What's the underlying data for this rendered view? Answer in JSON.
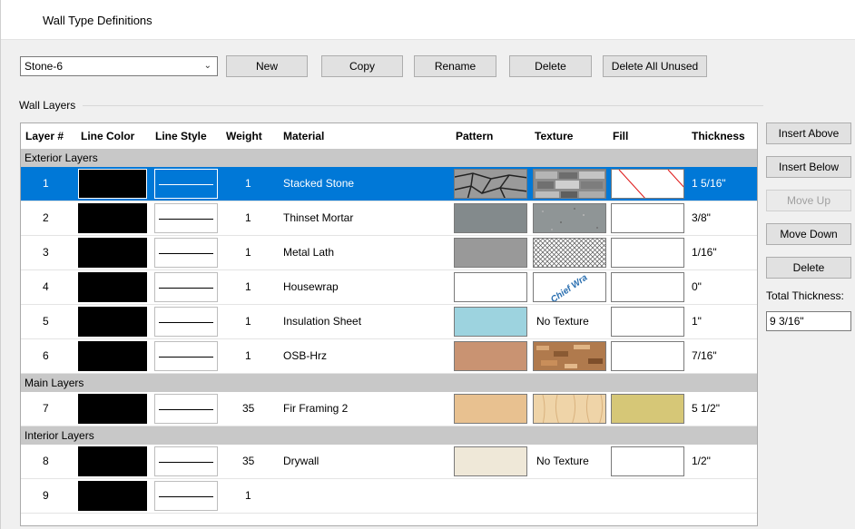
{
  "window": {
    "title": "Wall Type Definitions"
  },
  "toolbar": {
    "wall_type_value": "Stone-6",
    "new_label": "New",
    "copy_label": "Copy",
    "rename_label": "Rename",
    "delete_label": "Delete",
    "delete_all_unused_label": "Delete All Unused"
  },
  "group": {
    "label": "Wall Layers"
  },
  "columns": {
    "layer": "Layer #",
    "line_color": "Line Color",
    "line_style": "Line Style",
    "weight": "Weight",
    "material": "Material",
    "pattern": "Pattern",
    "texture": "Texture",
    "fill": "Fill",
    "thickness": "Thickness"
  },
  "sections": {
    "exterior": "Exterior Layers",
    "main": "Main Layers",
    "interior": "Interior Layers"
  },
  "rows": [
    {
      "layer": "1",
      "weight": "1",
      "material": "Stacked Stone",
      "thickness": "1 5/16\"",
      "pattern_color": "#9a9a9a",
      "texture": "stone-texture",
      "fill": "hatch-fill"
    },
    {
      "layer": "2",
      "weight": "1",
      "material": "Thinset Mortar",
      "thickness": "3/8\"",
      "pattern_color": "#838a8c",
      "texture": "gray-texture",
      "fill": "none"
    },
    {
      "layer": "3",
      "weight": "1",
      "material": "Metal Lath",
      "thickness": "1/16\"",
      "pattern_color": "#999999",
      "texture": "mesh-texture",
      "fill": "none"
    },
    {
      "layer": "4",
      "weight": "1",
      "material": "Housewrap",
      "thickness": "0\"",
      "pattern_color": "#ffffff",
      "texture": "housewrap-texture",
      "texture_text": "Chief Wra",
      "fill": "none"
    },
    {
      "layer": "5",
      "weight": "1",
      "material": "Insulation  Sheet",
      "thickness": "1\"",
      "pattern_color": "#9dd3df",
      "texture_text": "No Texture",
      "fill": "none"
    },
    {
      "layer": "6",
      "weight": "1",
      "material": "OSB-Hrz",
      "thickness": "7/16\"",
      "pattern_color": "#c99372",
      "texture": "osb-texture",
      "fill": "none"
    },
    {
      "layer": "7",
      "weight": "35",
      "material": "Fir Framing 2",
      "thickness": "5 1/2\"",
      "pattern_color": "#e8c190",
      "texture": "wood-texture",
      "fill_color": "#d6c777"
    },
    {
      "layer": "8",
      "weight": "35",
      "material": "Drywall",
      "thickness": "1/2\"",
      "pattern_color": "#efe8d8",
      "texture_text": "No Texture",
      "fill": "none"
    },
    {
      "layer": "9",
      "weight": "1"
    }
  ],
  "side": {
    "insert_above_label": "Insert Above",
    "insert_below_label": "Insert Below",
    "move_up_label": "Move Up",
    "move_down_label": "Move Down",
    "delete_label": "Delete",
    "total_thickness_label": "Total Thickness:",
    "total_thickness_value": "9 3/16\""
  },
  "colors": {
    "selection": "#0078d7",
    "section_bg": "#c8c8c8",
    "line_color": "#000000"
  }
}
